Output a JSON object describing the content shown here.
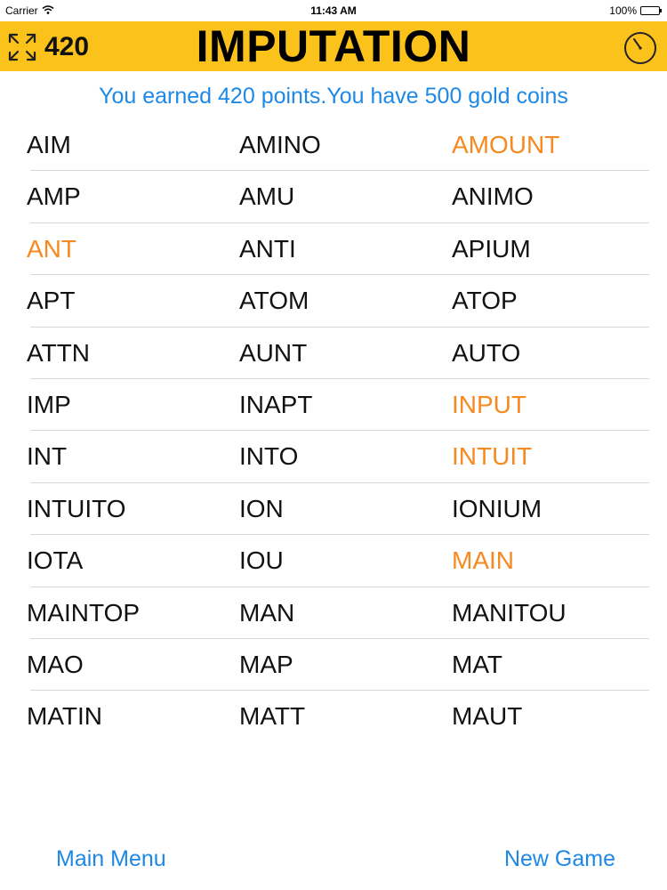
{
  "status_bar": {
    "carrier": "Carrier",
    "time": "11:43 AM",
    "battery": "100%"
  },
  "header": {
    "background_color": "#fbc21b",
    "score": "420",
    "title": "IMPUTATION",
    "expand_icon": "expand-arrows-icon",
    "timer_icon": "stopwatch-icon"
  },
  "message": "You earned 420 points.You have 500 gold coins",
  "accent_color": "#1e88e5",
  "highlight_color": "#f6891f",
  "words": [
    [
      {
        "text": "AIM",
        "found": false
      },
      {
        "text": "AMINO",
        "found": false
      },
      {
        "text": "AMOUNT",
        "found": true
      }
    ],
    [
      {
        "text": "AMP",
        "found": false
      },
      {
        "text": "AMU",
        "found": false
      },
      {
        "text": "ANIMO",
        "found": false
      }
    ],
    [
      {
        "text": "ANT",
        "found": true
      },
      {
        "text": "ANTI",
        "found": false
      },
      {
        "text": "APIUM",
        "found": false
      }
    ],
    [
      {
        "text": "APT",
        "found": false
      },
      {
        "text": "ATOM",
        "found": false
      },
      {
        "text": "ATOP",
        "found": false
      }
    ],
    [
      {
        "text": "ATTN",
        "found": false
      },
      {
        "text": "AUNT",
        "found": false
      },
      {
        "text": "AUTO",
        "found": false
      }
    ],
    [
      {
        "text": "IMP",
        "found": false
      },
      {
        "text": "INAPT",
        "found": false
      },
      {
        "text": "INPUT",
        "found": true
      }
    ],
    [
      {
        "text": "INT",
        "found": false
      },
      {
        "text": "INTO",
        "found": false
      },
      {
        "text": "INTUIT",
        "found": true
      }
    ],
    [
      {
        "text": "INTUITO",
        "found": false
      },
      {
        "text": "ION",
        "found": false
      },
      {
        "text": "IONIUM",
        "found": false
      }
    ],
    [
      {
        "text": "IOTA",
        "found": false
      },
      {
        "text": "IOU",
        "found": false
      },
      {
        "text": "MAIN",
        "found": true
      }
    ],
    [
      {
        "text": "MAINTOP",
        "found": false
      },
      {
        "text": "MAN",
        "found": false
      },
      {
        "text": "MANITOU",
        "found": false
      }
    ],
    [
      {
        "text": "MAO",
        "found": false
      },
      {
        "text": "MAP",
        "found": false
      },
      {
        "text": "MAT",
        "found": false
      }
    ],
    [
      {
        "text": "MATIN",
        "found": false
      },
      {
        "text": "MATT",
        "found": false
      },
      {
        "text": "MAUT",
        "found": false
      }
    ]
  ],
  "footer": {
    "main_menu_label": "Main Menu",
    "new_game_label": "New Game"
  }
}
